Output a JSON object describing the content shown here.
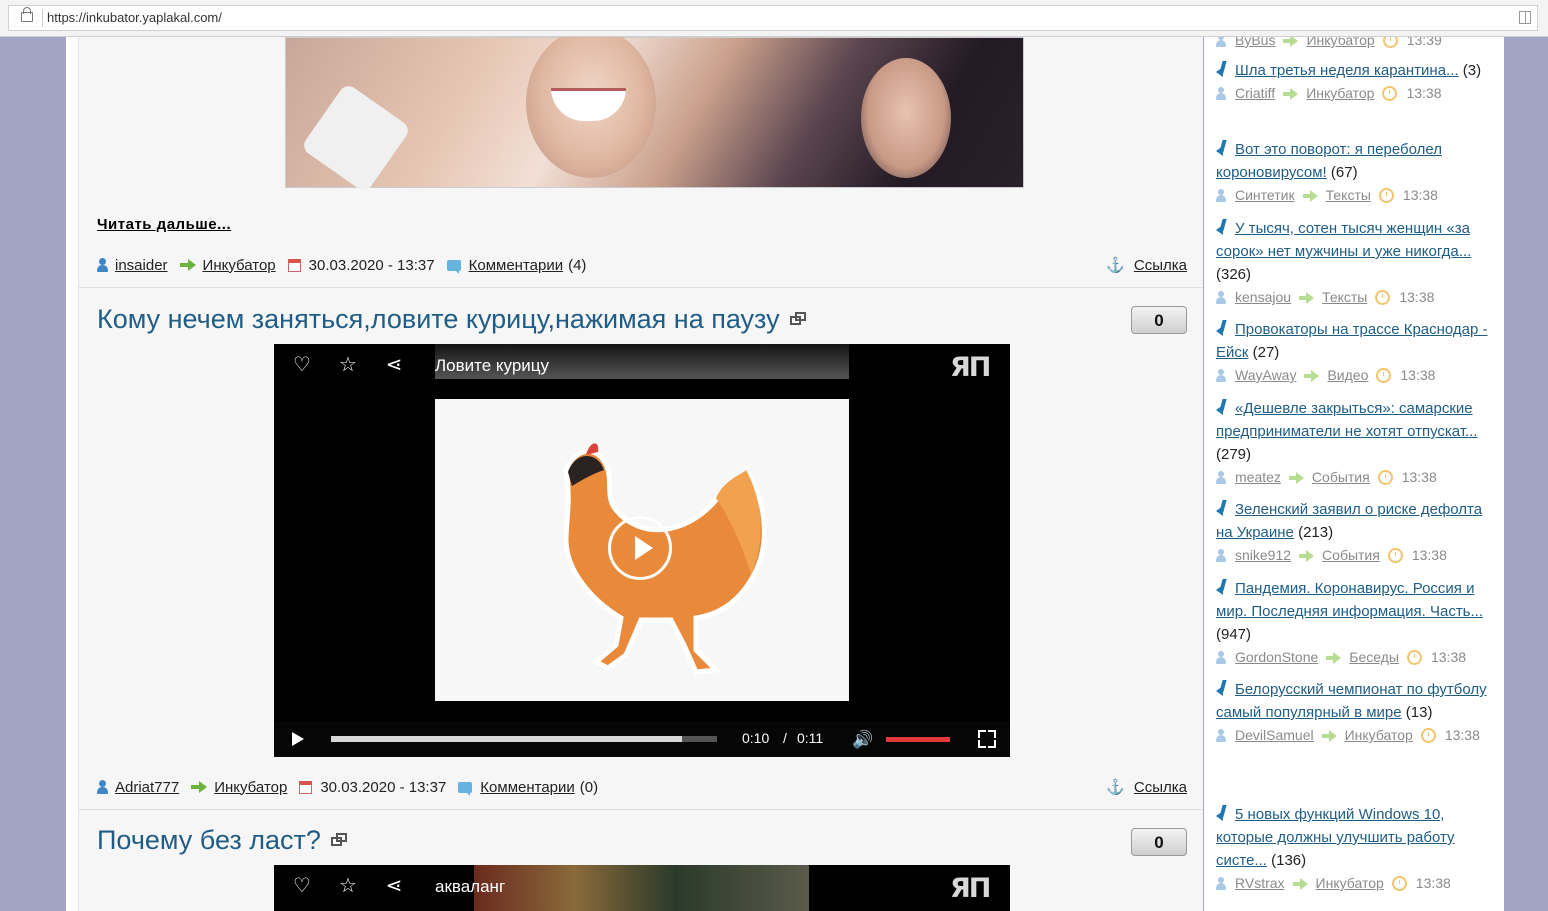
{
  "browser": {
    "url": "https://inkubator.yaplakal.com/"
  },
  "post1": {
    "read_more": "Читать дальше...",
    "author": "insaider",
    "section": "Инкубатор",
    "date": "30.03.2020 - 13:37",
    "comments_label": "Комментарии",
    "comments_count": "(4)",
    "link_label": "Ссылка"
  },
  "post2": {
    "title": "Кому нечем заняться,ловите курицу,нажимая на паузу",
    "votes": "0",
    "video": {
      "title": "Ловите курицу",
      "current_time": "0:10",
      "separator": "/",
      "duration": "0:11",
      "progress": 0.91,
      "volume": 1.0
    },
    "author": "Adriat777",
    "section": "Инкубатор",
    "date": "30.03.2020 - 13:37",
    "comments_label": "Комментарии",
    "comments_count": "(0)",
    "link_label": "Ссылка"
  },
  "post3": {
    "title": "Почему без ласт?",
    "votes": "0",
    "video": {
      "title": "акваланг"
    }
  },
  "video_logo": "ЯП",
  "sidebar": {
    "partial_top": {
      "author": "ByBus",
      "section": "Инкубатор",
      "time": "13:39"
    },
    "items": [
      {
        "title": "Шла третья неделя карантина...",
        "count": "(3)",
        "author": "Criatiff",
        "section": "Инкубатор",
        "time": "13:38"
      },
      {
        "title": "Вот это поворот: я переболел короновирусом!",
        "count": "(67)",
        "author": "Синтетик",
        "section": "Тексты",
        "time": "13:38"
      },
      {
        "title": "У тысяч, сотен тысяч женщин «за сорок» нет мужчины и уже никогда...",
        "count": "(326)",
        "author": "kensajou",
        "section": "Тексты",
        "time": "13:38"
      },
      {
        "title": "Провокаторы на трассе Краснодар - Ейск",
        "count": "(27)",
        "author": "WayAway",
        "section": "Видео",
        "time": "13:38"
      },
      {
        "title": "«Дешевле закрыться»: самарские предприниматели не хотят отпускат...",
        "count": "(279)",
        "author": "meatez",
        "section": "События",
        "time": "13:38"
      },
      {
        "title": "Зеленский заявил о риске дефолта на Украине",
        "count": "(213)",
        "author": "snike912",
        "section": "События",
        "time": "13:38"
      },
      {
        "title": "Пандемия. Коронавирус. Россия и мир. Последняя информация. Часть...",
        "count": "(947)",
        "author": "GordonStone",
        "section": "Беседы",
        "time": "13:38"
      },
      {
        "title": "Белорусский чемпионат по футболу самый популярный в мире",
        "count": "(13)",
        "author": "DevilSamuel",
        "section": "Инкубатор",
        "time": "13:38"
      },
      {
        "title": "5 новых функций Windows 10, которые должны улучшить работу систе...",
        "count": "(136)",
        "author": "RVstrax",
        "section": "Инкубатор",
        "time": "13:38"
      }
    ]
  },
  "icons": [
    "lock-icon",
    "reader-view-icon",
    "user-icon",
    "arrow-right-icon",
    "calendar-icon",
    "comment-icon",
    "anchor-icon",
    "external-window-icon",
    "heart-icon",
    "star-icon",
    "share-icon",
    "play-icon",
    "volume-icon",
    "fullscreen-icon",
    "pin-icon",
    "clock-icon"
  ]
}
